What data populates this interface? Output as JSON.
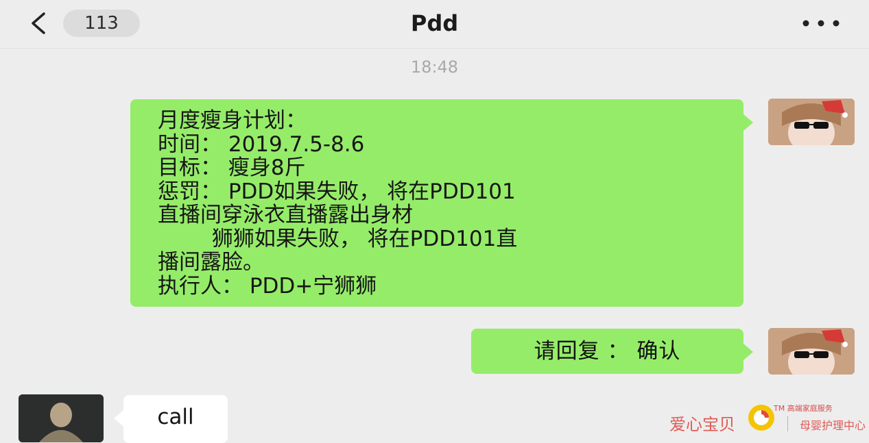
{
  "header": {
    "unread_count": "113",
    "title": "Pdd"
  },
  "timestamp": "18:48",
  "messages": {
    "plan_lines": [
      "月度瘦身计划：",
      "时间： 2019.7.5-8.6",
      "目标： 瘦身8斤",
      "惩罚： PDD如果失败， 将在PDD101",
      "直播间穿泳衣直播露出身材",
      "        狮狮如果失败， 将在PDD101直",
      "播间露脸。",
      "执行人： PDD+宁狮狮"
    ],
    "confirm": "请回复 ： 确认",
    "other_reply": "call"
  },
  "watermark": {
    "name": "爱心宝贝",
    "tm_text": "TM 高端家庭服务",
    "sub": "母婴护理中心"
  },
  "colors": {
    "background": "#ededed",
    "sent_bubble": "#95ec69",
    "received_bubble": "#ffffff",
    "watermark_red": "#e05a55"
  },
  "icons": {
    "back": "chevron-left-icon",
    "more": "more-dots-icon",
    "logo": "sun-logo-icon"
  }
}
